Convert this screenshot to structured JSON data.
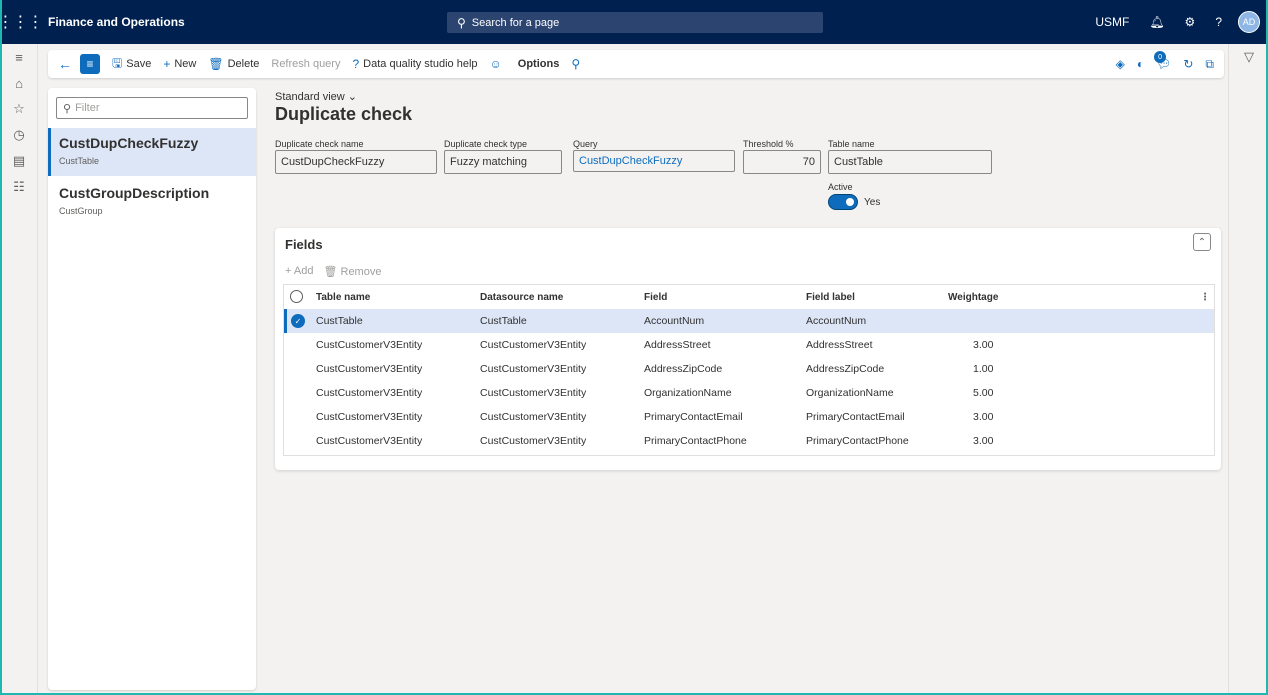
{
  "app": {
    "title": "Finance and Operations",
    "search_placeholder": "Search for a page",
    "company": "USMF",
    "avatar_initials": "AD"
  },
  "actions": {
    "save": "Save",
    "new": "New",
    "delete": "Delete",
    "refresh": "Refresh query",
    "help": "Data quality studio help",
    "options": "Options",
    "notification_count": "0"
  },
  "list": {
    "filter_placeholder": "Filter",
    "items": [
      {
        "title": "CustDupCheckFuzzy",
        "subtitle": "CustTable"
      },
      {
        "title": "CustGroupDescription",
        "subtitle": "CustGroup"
      }
    ]
  },
  "main": {
    "view": "Standard view",
    "title": "Duplicate check",
    "fields": {
      "name_label": "Duplicate check name",
      "name_value": "CustDupCheckFuzzy",
      "type_label": "Duplicate check type",
      "type_value": "Fuzzy matching",
      "query_label": "Query",
      "query_value": "CustDupCheckFuzzy",
      "threshold_label": "Threshold %",
      "threshold_value": "70",
      "table_label": "Table name",
      "table_value": "CustTable",
      "active_label": "Active",
      "active_value": "Yes"
    }
  },
  "grid": {
    "title": "Fields",
    "add": "Add",
    "remove": "Remove",
    "columns": [
      "Table name",
      "Datasource name",
      "Field",
      "Field label",
      "Weightage"
    ],
    "rows": [
      [
        "CustTable",
        "CustTable",
        "AccountNum",
        "AccountNum",
        ""
      ],
      [
        "CustCustomerV3Entity",
        "CustCustomerV3Entity",
        "AddressStreet",
        "AddressStreet",
        "3.00"
      ],
      [
        "CustCustomerV3Entity",
        "CustCustomerV3Entity",
        "AddressZipCode",
        "AddressZipCode",
        "1.00"
      ],
      [
        "CustCustomerV3Entity",
        "CustCustomerV3Entity",
        "OrganizationName",
        "OrganizationName",
        "5.00"
      ],
      [
        "CustCustomerV3Entity",
        "CustCustomerV3Entity",
        "PrimaryContactEmail",
        "PrimaryContactEmail",
        "3.00"
      ],
      [
        "CustCustomerV3Entity",
        "CustCustomerV3Entity",
        "PrimaryContactPhone",
        "PrimaryContactPhone",
        "3.00"
      ]
    ]
  }
}
